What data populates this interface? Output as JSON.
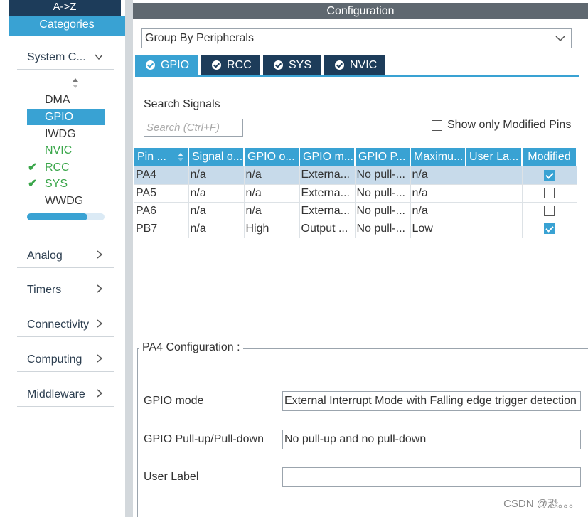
{
  "sidebar": {
    "az_label": "A->Z",
    "categories_label": "Categories",
    "system_core": {
      "label": "System C...",
      "items": [
        {
          "label": "DMA",
          "state": "normal"
        },
        {
          "label": "GPIO",
          "state": "selected"
        },
        {
          "label": "IWDG",
          "state": "normal"
        },
        {
          "label": "NVIC",
          "state": "green"
        },
        {
          "label": "RCC",
          "state": "checked"
        },
        {
          "label": "SYS",
          "state": "checked"
        },
        {
          "label": "WWDG",
          "state": "normal"
        }
      ]
    },
    "sections": [
      {
        "label": "Analog"
      },
      {
        "label": "Timers"
      },
      {
        "label": "Connectivity"
      },
      {
        "label": "Computing"
      },
      {
        "label": "Middleware"
      }
    ]
  },
  "main": {
    "title": "Configuration",
    "group_select": "Group By Peripherals",
    "tabs": [
      {
        "label": "GPIO"
      },
      {
        "label": "RCC"
      },
      {
        "label": "SYS"
      },
      {
        "label": "NVIC"
      }
    ],
    "search_label": "Search Signals",
    "search_placeholder": "Search (Ctrl+F)",
    "show_modified_label": "Show only Modified Pins",
    "table": {
      "headers": [
        "Pin ...",
        "Signal o...",
        "GPIO o...",
        "GPIO m...",
        "GPIO P...",
        "Maximu...",
        "User La...",
        "Modified"
      ],
      "rows": [
        {
          "pin": "PA4",
          "signal": "n/a",
          "gpio_out": "n/a",
          "mode": "Externa...",
          "pull": "No pull-...",
          "max": "n/a",
          "label": "",
          "modified": true
        },
        {
          "pin": "PA5",
          "signal": "n/a",
          "gpio_out": "n/a",
          "mode": "Externa...",
          "pull": "No pull-...",
          "max": "n/a",
          "label": "",
          "modified": false
        },
        {
          "pin": "PA6",
          "signal": "n/a",
          "gpio_out": "n/a",
          "mode": "Externa...",
          "pull": "No pull-...",
          "max": "n/a",
          "label": "",
          "modified": false
        },
        {
          "pin": "PB7",
          "signal": "n/a",
          "gpio_out": "High",
          "mode": "Output ...",
          "pull": "No pull-...",
          "max": "Low",
          "label": "",
          "modified": true
        }
      ]
    },
    "config": {
      "legend": "PA4 Configuration :",
      "gpio_mode_label": "GPIO mode",
      "gpio_mode_value": "External Interrupt Mode with Falling edge trigger detection",
      "pull_label": "GPIO Pull-up/Pull-down",
      "pull_value": "No pull-up and no pull-down",
      "user_label_label": "User Label",
      "user_label_value": ""
    }
  },
  "watermark": "CSDN @恐。。。",
  "colors": {
    "accent": "#39a2d3",
    "dark": "#1d3c5a",
    "green": "#3aa64a",
    "title_bar": "#5f6870"
  }
}
